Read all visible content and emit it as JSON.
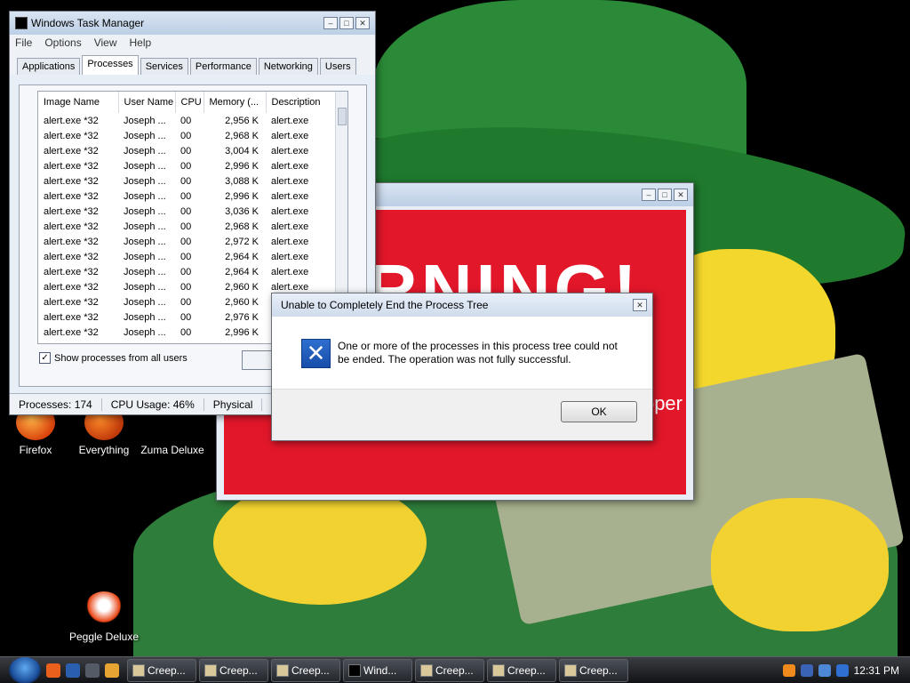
{
  "desktop": {
    "icons": [
      {
        "label": "Firefox"
      },
      {
        "label": "Everything"
      },
      {
        "label": "Zuma Deluxe"
      },
      {
        "label": "Peggle Deluxe"
      }
    ]
  },
  "task_manager": {
    "title": "Windows Task Manager",
    "menu": [
      "File",
      "Options",
      "View",
      "Help"
    ],
    "tabs": [
      "Applications",
      "Processes",
      "Services",
      "Performance",
      "Networking",
      "Users"
    ],
    "active_tab": "Processes",
    "columns": [
      "Image Name",
      "User Name",
      "CPU",
      "Memory (...",
      "Description"
    ],
    "rows": [
      {
        "image": "alert.exe *32",
        "user": "Joseph ...",
        "cpu": "00",
        "mem": "2,956 K",
        "desc": "alert.exe"
      },
      {
        "image": "alert.exe *32",
        "user": "Joseph ...",
        "cpu": "00",
        "mem": "2,968 K",
        "desc": "alert.exe"
      },
      {
        "image": "alert.exe *32",
        "user": "Joseph ...",
        "cpu": "00",
        "mem": "3,004 K",
        "desc": "alert.exe"
      },
      {
        "image": "alert.exe *32",
        "user": "Joseph ...",
        "cpu": "00",
        "mem": "2,996 K",
        "desc": "alert.exe"
      },
      {
        "image": "alert.exe *32",
        "user": "Joseph ...",
        "cpu": "00",
        "mem": "3,088 K",
        "desc": "alert.exe"
      },
      {
        "image": "alert.exe *32",
        "user": "Joseph ...",
        "cpu": "00",
        "mem": "2,996 K",
        "desc": "alert.exe"
      },
      {
        "image": "alert.exe *32",
        "user": "Joseph ...",
        "cpu": "00",
        "mem": "3,036 K",
        "desc": "alert.exe"
      },
      {
        "image": "alert.exe *32",
        "user": "Joseph ...",
        "cpu": "00",
        "mem": "2,968 K",
        "desc": "alert.exe"
      },
      {
        "image": "alert.exe *32",
        "user": "Joseph ...",
        "cpu": "00",
        "mem": "2,972 K",
        "desc": "alert.exe"
      },
      {
        "image": "alert.exe *32",
        "user": "Joseph ...",
        "cpu": "00",
        "mem": "2,964 K",
        "desc": "alert.exe"
      },
      {
        "image": "alert.exe *32",
        "user": "Joseph ...",
        "cpu": "00",
        "mem": "2,964 K",
        "desc": "alert.exe"
      },
      {
        "image": "alert.exe *32",
        "user": "Joseph ...",
        "cpu": "00",
        "mem": "2,960 K",
        "desc": "alert.exe"
      },
      {
        "image": "alert.exe *32",
        "user": "Joseph ...",
        "cpu": "00",
        "mem": "2,960 K",
        "desc": "alert.exe"
      },
      {
        "image": "alert.exe *32",
        "user": "Joseph ...",
        "cpu": "00",
        "mem": "2,976 K",
        "desc": "alert.exe"
      },
      {
        "image": "alert.exe *32",
        "user": "Joseph ...",
        "cpu": "00",
        "mem": "2,996 K",
        "desc": "alert.exe"
      }
    ],
    "show_all_label": "Show processes from all users",
    "show_all_checked": "✓",
    "status": {
      "processes": "Processes: 174",
      "cpu": "CPU Usage: 46%",
      "physical": "Physical"
    }
  },
  "warning_window": {
    "big_text": "RNING!",
    "side_text": "pper"
  },
  "error_dialog": {
    "title": "Unable to Completely End the Process Tree",
    "message": "One or more of the processes in this process tree could not be ended.  The operation was not fully successful.",
    "icon": "✕",
    "ok_label": "OK"
  },
  "taskbar": {
    "buttons": [
      {
        "label": "Creep..."
      },
      {
        "label": "Creep..."
      },
      {
        "label": "Creep..."
      },
      {
        "label": "Wind..."
      },
      {
        "label": "Creep..."
      },
      {
        "label": "Creep..."
      },
      {
        "label": "Creep..."
      }
    ],
    "clock": "12:31 PM"
  }
}
